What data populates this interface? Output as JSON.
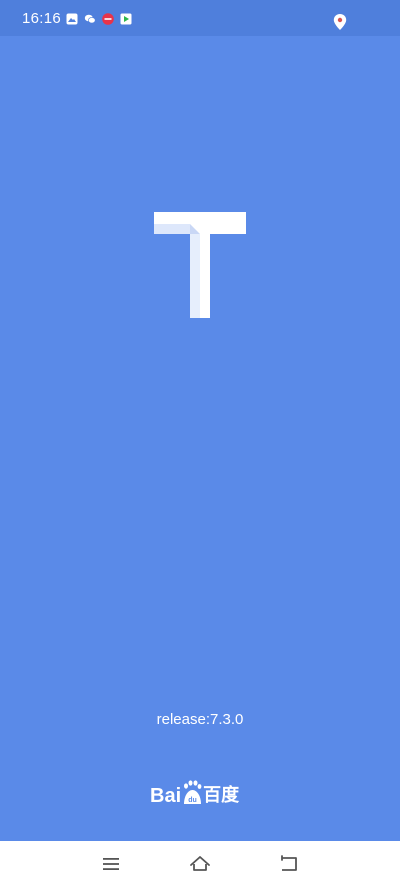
{
  "status_bar": {
    "time": "16:16",
    "notification_icons": [
      "gallery-app-icon",
      "wechat-icon",
      "news-app-icon",
      "video-app-icon"
    ],
    "right_icons": [
      "location-pin-icon"
    ]
  },
  "splash": {
    "logo_letter": "T",
    "release": "release:7.3.0",
    "brand_latin": "Bai",
    "brand_cjk": "百度",
    "background_color": "#5a8ae8"
  },
  "nav_bar": {
    "buttons": [
      "menu-icon",
      "home-icon",
      "back-icon"
    ]
  }
}
